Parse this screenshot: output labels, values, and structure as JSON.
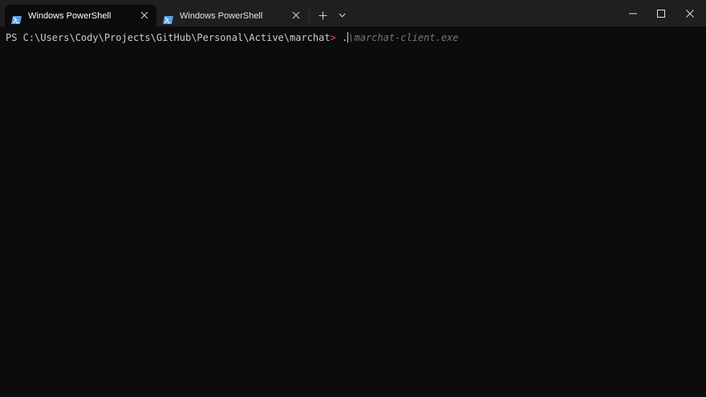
{
  "tabs": [
    {
      "label": "Windows PowerShell",
      "icon": "powershell-icon",
      "active": true
    },
    {
      "label": "Windows PowerShell",
      "icon": "powershell-icon",
      "active": false
    }
  ],
  "terminal": {
    "prompt_path": "PS C:\\Users\\Cody\\Projects\\GitHub\\Personal\\Active\\marchat",
    "prompt_symbol": ">",
    "typed": " .",
    "suggestion": "\\marchat-client.exe"
  },
  "colors": {
    "titlebar": "#1f1f1f",
    "terminal_bg": "#0c0c0c",
    "text": "#cccccc",
    "prompt_symbol": "#e74856",
    "suggestion": "#767676",
    "powershell_icon": "#5aa0e6"
  }
}
